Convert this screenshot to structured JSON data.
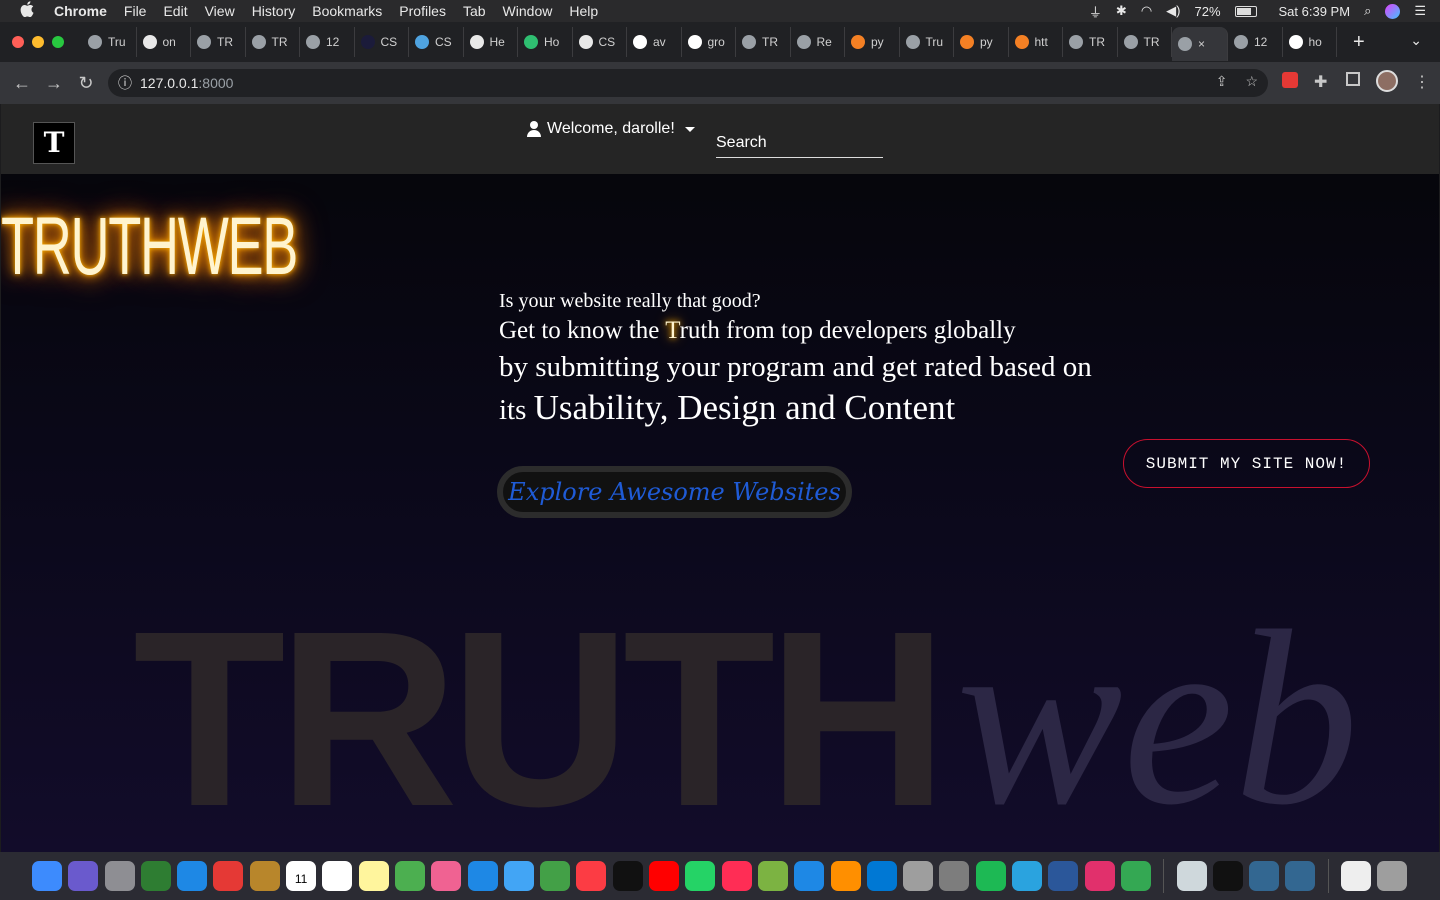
{
  "menubar": {
    "apple": "",
    "items": [
      "Chrome",
      "File",
      "Edit",
      "View",
      "History",
      "Bookmarks",
      "Profiles",
      "Tab",
      "Window",
      "Help"
    ],
    "battery": "72%",
    "clock": "Sat 6:39 PM"
  },
  "tabs": [
    {
      "label": "Tru",
      "icon": "globe-icon"
    },
    {
      "label": "on",
      "icon": "github-icon"
    },
    {
      "label": "TR",
      "icon": "globe-icon"
    },
    {
      "label": "TR",
      "icon": "globe-icon"
    },
    {
      "label": "12",
      "icon": "globe-icon"
    },
    {
      "label": "CS",
      "icon": "angular-icon"
    },
    {
      "label": "CS",
      "icon": "css-icon"
    },
    {
      "label": "He",
      "icon": "codepen-icon"
    },
    {
      "label": "Ho",
      "icon": "webflow-icon"
    },
    {
      "label": "CS",
      "icon": "codepen-icon"
    },
    {
      "label": "av",
      "icon": "google-icon"
    },
    {
      "label": "gro",
      "icon": "google-icon"
    },
    {
      "label": "TR",
      "icon": "globe-icon"
    },
    {
      "label": "Re",
      "icon": "globe-icon"
    },
    {
      "label": "py",
      "icon": "stackoverflow-icon"
    },
    {
      "label": "Tru",
      "icon": "globe-icon"
    },
    {
      "label": "py",
      "icon": "stackoverflow-icon"
    },
    {
      "label": "htt",
      "icon": "stackoverflow-icon"
    },
    {
      "label": "TR",
      "icon": "globe-icon"
    },
    {
      "label": "TR",
      "icon": "globe-icon"
    },
    {
      "label": "×",
      "icon": "globe-icon",
      "active": true
    },
    {
      "label": "12",
      "icon": "globe-icon"
    },
    {
      "label": "ho",
      "icon": "google-icon"
    }
  ],
  "address": {
    "host": "127.0.0.1",
    "port": ":8000"
  },
  "page": {
    "welcome": "Welcome, darolle!",
    "search_placeholder": "Search",
    "neon_title": "TRUTHWEB",
    "hero": {
      "line1": "Is your website really that good?",
      "line2_pre": "Get to know the ",
      "line2_glow": "T",
      "line2_post": "ruth from top developers globally",
      "line3": "by submitting your program and get rated based on",
      "line4_pre": "its ",
      "line4_big": "Usability, Design and Content"
    },
    "explore_button": "Explore Awesome Websites",
    "submit_button": "SUBMIT MY SITE NOW!",
    "bg_truth": "TRUTH",
    "bg_web": "web"
  },
  "dock": {
    "icons": [
      "finder-icon",
      "siri-icon",
      "launchpad-icon",
      "mission-control-icon",
      "safari-icon",
      "chrome-icon",
      "notes-icon",
      "calendar-icon",
      "reminders-icon",
      "stickies-icon",
      "maps-icon",
      "photos-icon",
      "vscode-icon",
      "messages-icon",
      "facetime-icon",
      "music-icon",
      "apple-tv-icon",
      "youtube-icon",
      "whatsapp-icon",
      "news-icon",
      "bluestacks-icon",
      "app-store-icon",
      "vlc-icon",
      "edge-icon",
      "screenshot-icon",
      "system-preferences-icon",
      "spotify-icon",
      "telegram-icon",
      "word-icon",
      "instagram-icon",
      "sheets-icon",
      "preview-icon",
      "terminal-icon",
      "postgres-icon",
      "postgres-icon",
      "document-icon",
      "trash-icon"
    ],
    "calendar_date": "11",
    "calendar_month": "JUN"
  },
  "colors": {
    "accent_submit": "#c8102e",
    "explore_text": "#1f5bd6",
    "neon_glow": "#ff9800"
  }
}
